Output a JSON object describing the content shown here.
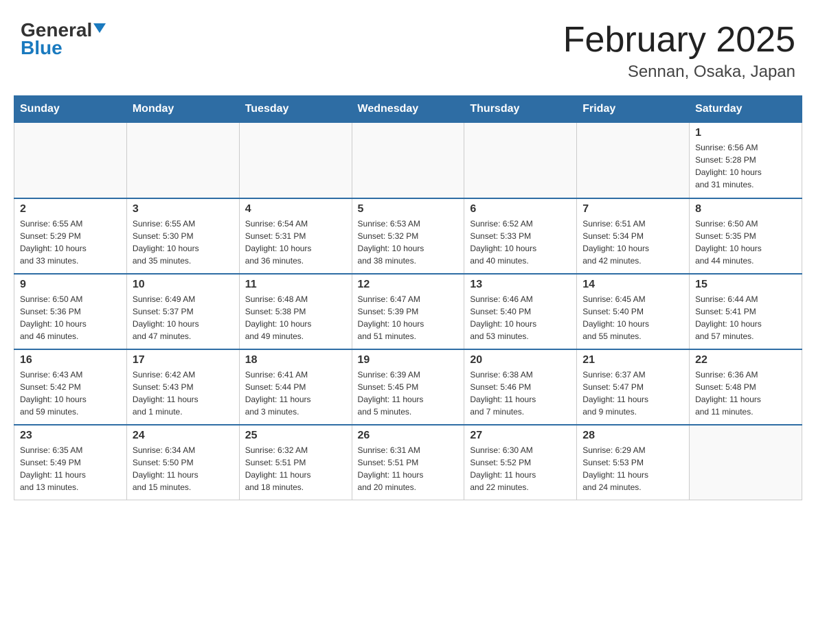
{
  "header": {
    "logo_general": "General",
    "logo_blue": "Blue",
    "title": "February 2025",
    "subtitle": "Sennan, Osaka, Japan"
  },
  "days_of_week": [
    "Sunday",
    "Monday",
    "Tuesday",
    "Wednesday",
    "Thursday",
    "Friday",
    "Saturday"
  ],
  "weeks": [
    [
      {
        "day": "",
        "info": ""
      },
      {
        "day": "",
        "info": ""
      },
      {
        "day": "",
        "info": ""
      },
      {
        "day": "",
        "info": ""
      },
      {
        "day": "",
        "info": ""
      },
      {
        "day": "",
        "info": ""
      },
      {
        "day": "1",
        "info": "Sunrise: 6:56 AM\nSunset: 5:28 PM\nDaylight: 10 hours\nand 31 minutes."
      }
    ],
    [
      {
        "day": "2",
        "info": "Sunrise: 6:55 AM\nSunset: 5:29 PM\nDaylight: 10 hours\nand 33 minutes."
      },
      {
        "day": "3",
        "info": "Sunrise: 6:55 AM\nSunset: 5:30 PM\nDaylight: 10 hours\nand 35 minutes."
      },
      {
        "day": "4",
        "info": "Sunrise: 6:54 AM\nSunset: 5:31 PM\nDaylight: 10 hours\nand 36 minutes."
      },
      {
        "day": "5",
        "info": "Sunrise: 6:53 AM\nSunset: 5:32 PM\nDaylight: 10 hours\nand 38 minutes."
      },
      {
        "day": "6",
        "info": "Sunrise: 6:52 AM\nSunset: 5:33 PM\nDaylight: 10 hours\nand 40 minutes."
      },
      {
        "day": "7",
        "info": "Sunrise: 6:51 AM\nSunset: 5:34 PM\nDaylight: 10 hours\nand 42 minutes."
      },
      {
        "day": "8",
        "info": "Sunrise: 6:50 AM\nSunset: 5:35 PM\nDaylight: 10 hours\nand 44 minutes."
      }
    ],
    [
      {
        "day": "9",
        "info": "Sunrise: 6:50 AM\nSunset: 5:36 PM\nDaylight: 10 hours\nand 46 minutes."
      },
      {
        "day": "10",
        "info": "Sunrise: 6:49 AM\nSunset: 5:37 PM\nDaylight: 10 hours\nand 47 minutes."
      },
      {
        "day": "11",
        "info": "Sunrise: 6:48 AM\nSunset: 5:38 PM\nDaylight: 10 hours\nand 49 minutes."
      },
      {
        "day": "12",
        "info": "Sunrise: 6:47 AM\nSunset: 5:39 PM\nDaylight: 10 hours\nand 51 minutes."
      },
      {
        "day": "13",
        "info": "Sunrise: 6:46 AM\nSunset: 5:40 PM\nDaylight: 10 hours\nand 53 minutes."
      },
      {
        "day": "14",
        "info": "Sunrise: 6:45 AM\nSunset: 5:40 PM\nDaylight: 10 hours\nand 55 minutes."
      },
      {
        "day": "15",
        "info": "Sunrise: 6:44 AM\nSunset: 5:41 PM\nDaylight: 10 hours\nand 57 minutes."
      }
    ],
    [
      {
        "day": "16",
        "info": "Sunrise: 6:43 AM\nSunset: 5:42 PM\nDaylight: 10 hours\nand 59 minutes."
      },
      {
        "day": "17",
        "info": "Sunrise: 6:42 AM\nSunset: 5:43 PM\nDaylight: 11 hours\nand 1 minute."
      },
      {
        "day": "18",
        "info": "Sunrise: 6:41 AM\nSunset: 5:44 PM\nDaylight: 11 hours\nand 3 minutes."
      },
      {
        "day": "19",
        "info": "Sunrise: 6:39 AM\nSunset: 5:45 PM\nDaylight: 11 hours\nand 5 minutes."
      },
      {
        "day": "20",
        "info": "Sunrise: 6:38 AM\nSunset: 5:46 PM\nDaylight: 11 hours\nand 7 minutes."
      },
      {
        "day": "21",
        "info": "Sunrise: 6:37 AM\nSunset: 5:47 PM\nDaylight: 11 hours\nand 9 minutes."
      },
      {
        "day": "22",
        "info": "Sunrise: 6:36 AM\nSunset: 5:48 PM\nDaylight: 11 hours\nand 11 minutes."
      }
    ],
    [
      {
        "day": "23",
        "info": "Sunrise: 6:35 AM\nSunset: 5:49 PM\nDaylight: 11 hours\nand 13 minutes."
      },
      {
        "day": "24",
        "info": "Sunrise: 6:34 AM\nSunset: 5:50 PM\nDaylight: 11 hours\nand 15 minutes."
      },
      {
        "day": "25",
        "info": "Sunrise: 6:32 AM\nSunset: 5:51 PM\nDaylight: 11 hours\nand 18 minutes."
      },
      {
        "day": "26",
        "info": "Sunrise: 6:31 AM\nSunset: 5:51 PM\nDaylight: 11 hours\nand 20 minutes."
      },
      {
        "day": "27",
        "info": "Sunrise: 6:30 AM\nSunset: 5:52 PM\nDaylight: 11 hours\nand 22 minutes."
      },
      {
        "day": "28",
        "info": "Sunrise: 6:29 AM\nSunset: 5:53 PM\nDaylight: 11 hours\nand 24 minutes."
      },
      {
        "day": "",
        "info": ""
      }
    ]
  ]
}
